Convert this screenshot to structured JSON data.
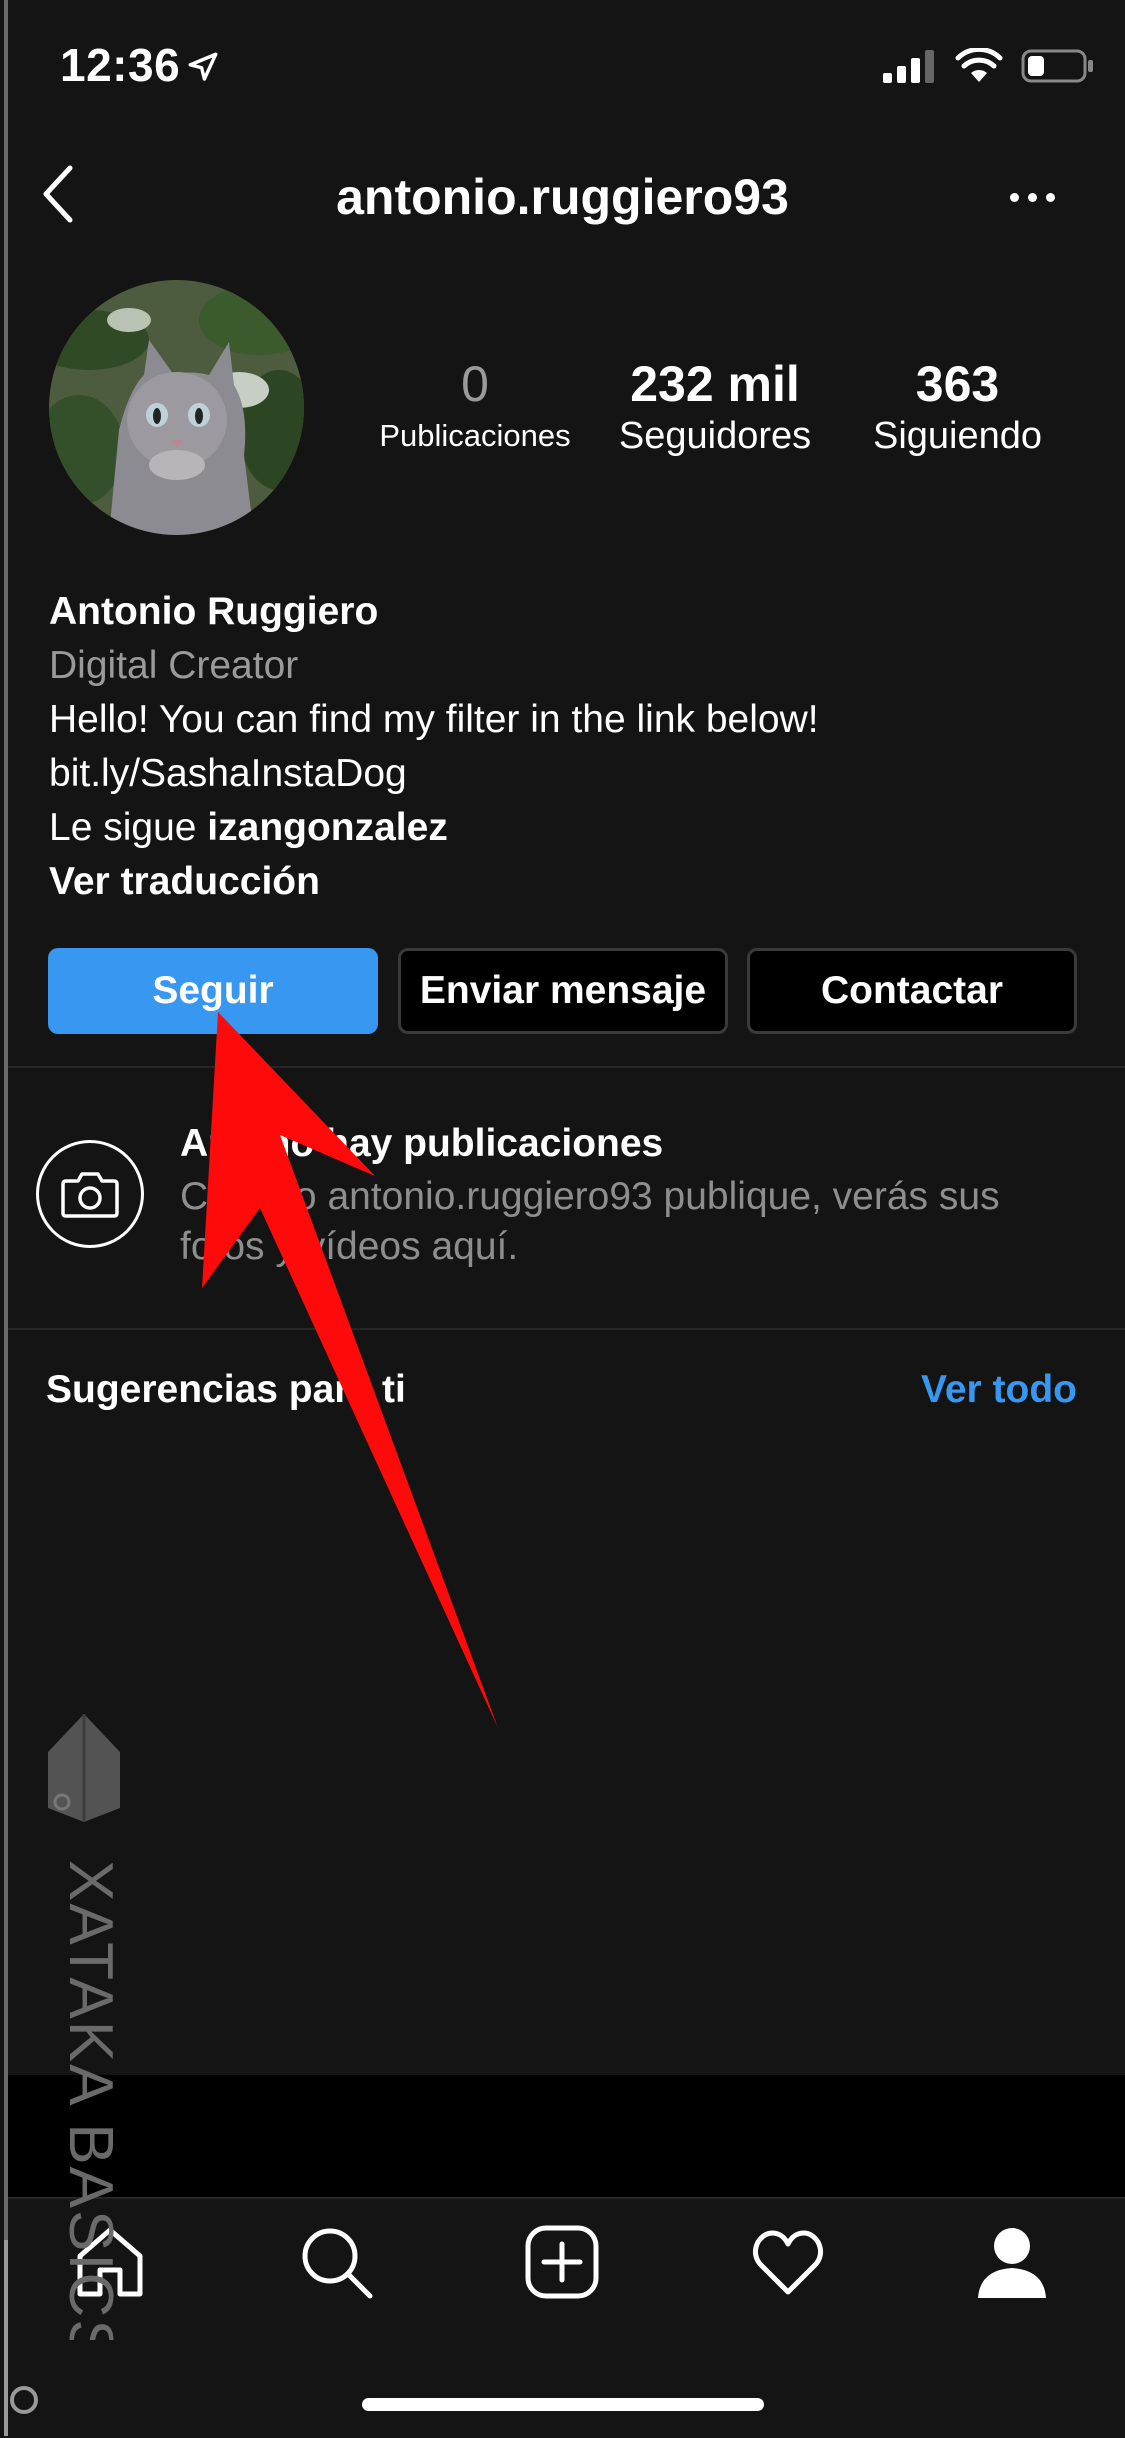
{
  "status_bar": {
    "time": "12:36"
  },
  "header": {
    "username": "antonio.ruggiero93"
  },
  "stats": {
    "posts": {
      "value": "0",
      "label": "Publicaciones"
    },
    "followers": {
      "value": "232 mil",
      "label": "Seguidores"
    },
    "following": {
      "value": "363",
      "label": "Siguiendo"
    }
  },
  "bio": {
    "name": "Antonio Ruggiero",
    "category": "Digital Creator",
    "text": "Hello! You can find my filter in the link below!",
    "link": "bit.ly/SashaInstaDog",
    "followed_by_prefix": "Le sigue ",
    "followed_by_user": "izangonzalez",
    "translate": "Ver traducción"
  },
  "actions": {
    "follow": "Seguir",
    "message": "Enviar mensaje",
    "contact": "Contactar"
  },
  "empty_posts": {
    "title": "Aún no hay publicaciones",
    "description": "Cuando antonio.ruggiero93 publique, verás sus fotos y vídeos aquí."
  },
  "suggestions": {
    "title": "Sugerencias para ti",
    "see_all": "Ver todo"
  },
  "watermark": {
    "text": "XATAKA BASICS"
  },
  "colors": {
    "accent": "#3897f0",
    "background": "#141414",
    "arrow": "#ff0a0a"
  },
  "icons": [
    "back-icon",
    "more-icon",
    "camera-icon",
    "home-icon",
    "search-icon",
    "add-icon",
    "heart-icon",
    "profile-icon",
    "location-arrow-icon",
    "signal-icon",
    "wifi-icon",
    "battery-icon"
  ]
}
